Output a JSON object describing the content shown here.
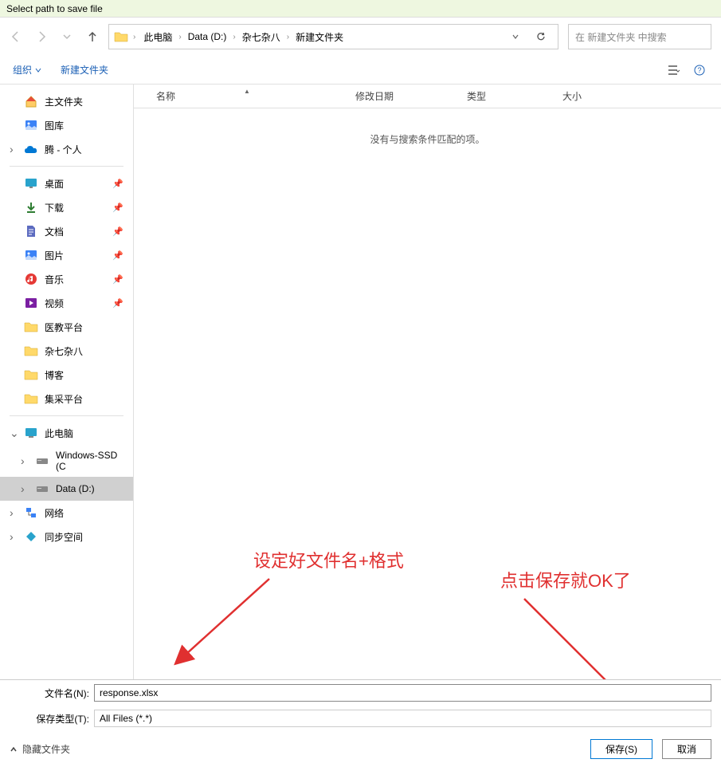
{
  "title": "Select path to save file",
  "breadcrumb": [
    "此电脑",
    "Data (D:)",
    "杂七杂八",
    "新建文件夹"
  ],
  "search_placeholder": "在 新建文件夹 中搜索",
  "toolbar": {
    "organize": "组织",
    "new_folder": "新建文件夹"
  },
  "columns": {
    "name": "名称",
    "date": "修改日期",
    "type": "类型",
    "size": "大小"
  },
  "empty_message": "没有与搜索条件匹配的项。",
  "sidebar": {
    "home": "主文件夹",
    "gallery": "图库",
    "onedrive": "腾 - 个人",
    "desktop": "桌面",
    "downloads": "下载",
    "documents": "文档",
    "pictures": "图片",
    "music": "音乐",
    "videos": "视频",
    "folder1": "医教平台",
    "folder2": "杂七杂八",
    "folder3": "博客",
    "folder4": "集采平台",
    "thispc": "此电脑",
    "drive_c": "Windows-SSD (C",
    "drive_d": "Data (D:)",
    "network": "网络",
    "sync": "同步空间"
  },
  "filename_label": "文件名(N):",
  "filename_value": "response.xlsx",
  "filetype_label": "保存类型(T):",
  "filetype_value": "All Files (*.*)",
  "hide_folders": "隐藏文件夹",
  "save_button": "保存(S)",
  "cancel_button": "取消",
  "annotations": {
    "left": "设定好文件名+格式",
    "right": "点击保存就OK了"
  }
}
